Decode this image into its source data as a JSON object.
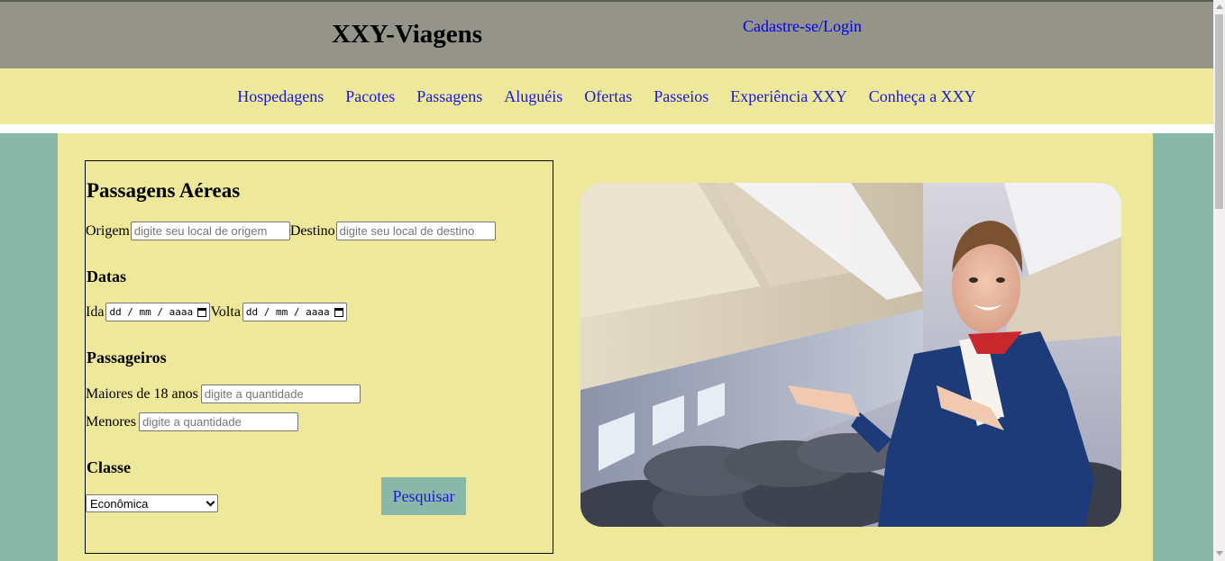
{
  "header": {
    "title": "XXY-Viagens",
    "login_link": "Cadastre-se/Login"
  },
  "nav": {
    "items": [
      "Hospedagens",
      "Pacotes",
      "Passagens",
      "Aluguéis",
      "Ofertas",
      "Passeios",
      "Experiência XXY",
      "Conheça a XXY"
    ]
  },
  "form": {
    "title": "Passagens Aéreas",
    "origin_label": "Origem",
    "origin_placeholder": "digite seu local de origem",
    "destination_label": "Destino",
    "destination_placeholder": "digite seu local de destino",
    "dates_title": "Datas",
    "depart_label": "Ida",
    "return_label": "Volta",
    "date_placeholder": "dd / mm / aaaa",
    "passengers_title": "Passageiros",
    "adults_label": "Maiores de 18 anos",
    "adults_placeholder": "digite a quantidade",
    "minors_label": "Menores",
    "minors_placeholder": "digite a quantidade",
    "class_title": "Classe",
    "class_selected": "Econômica",
    "search_button": "Pesquisar"
  },
  "colors": {
    "header_bg": "#949488",
    "nav_bg": "#eee89a",
    "page_bg": "#8ab8a8",
    "link": "#1a1ad6"
  }
}
